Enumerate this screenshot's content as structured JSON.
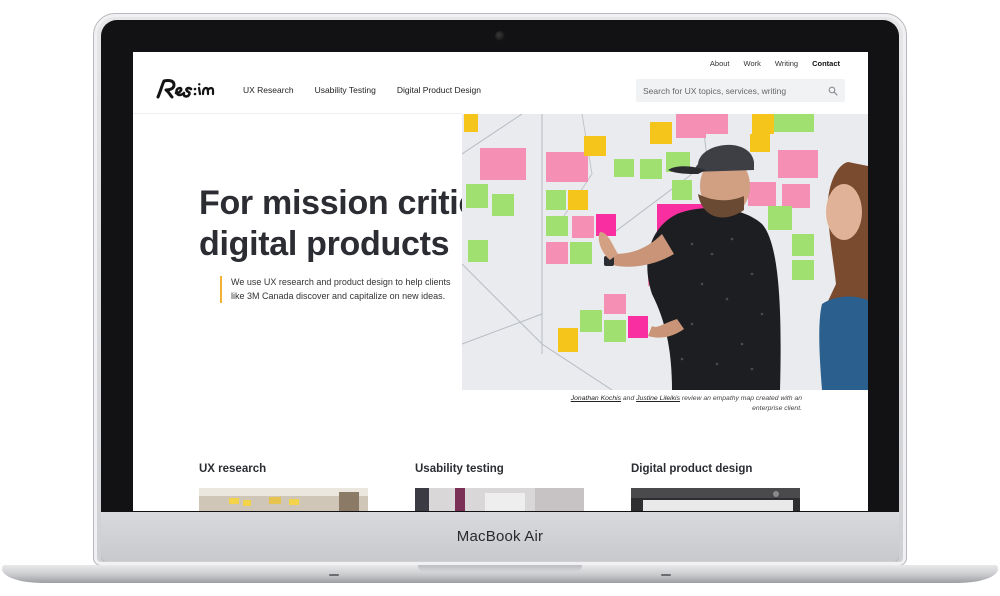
{
  "device": {
    "label": "MacBook Air"
  },
  "site": {
    "logo_text": "Res:in",
    "top_links": [
      "About",
      "Work",
      "Writing",
      "Contact"
    ],
    "main_nav": [
      "UX Research",
      "Usability Testing",
      "Digital Product Design"
    ],
    "search": {
      "placeholder": "Search for UX topics, services, writing"
    }
  },
  "hero": {
    "title_line1": "For mission critical",
    "title_line2": "digital products",
    "description": "We use UX research and product design to help clients like 3M Canada discover and capitalize on new ideas.",
    "caption": {
      "name1": "Jonathan Kochis",
      "and": "and",
      "name2": "Justine Lileikis",
      "text": "review an empathy map created with an enterprise client."
    }
  },
  "cards": [
    {
      "title": "UX research"
    },
    {
      "title": "Usability testing"
    },
    {
      "title": "Digital product design"
    }
  ],
  "colors": {
    "accent": "#f2b233",
    "heading": "#2b2d33",
    "search_bg": "#f1f2f4"
  }
}
